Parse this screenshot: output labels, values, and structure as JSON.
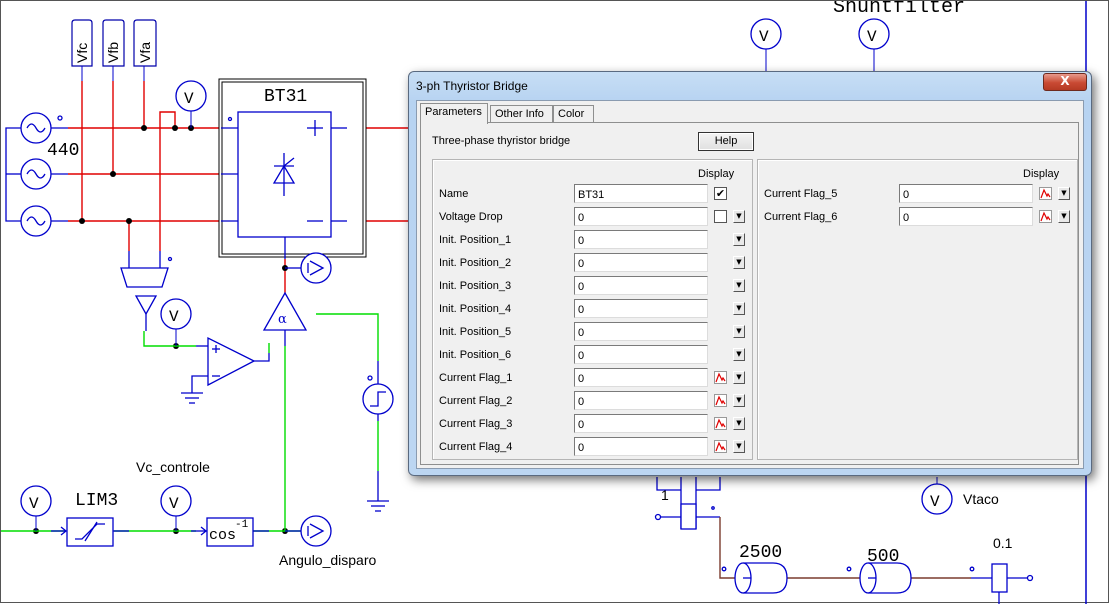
{
  "schematic": {
    "labels": {
      "vfc": "Vfc",
      "vfb": "Vfb",
      "vfa": "Vfa",
      "source_voltage": "440",
      "bridge_name": "BT31",
      "voltmeter": "V",
      "lim_block": "LIM3",
      "vc_controle": "Vc_controle",
      "cos_inverse": "cos",
      "cos_exponent": "-1",
      "angulo_disparo": "Angulo_disparo",
      "shunt_filter": "Shuntfilter",
      "vtaco": "Vtaco",
      "gain_1": "1",
      "inertia_2500": "2500",
      "inertia_500": "500",
      "damping_01": "0.1",
      "alpha_symbol": "α"
    },
    "wire_colors": {
      "power": "#e00000",
      "control": "#00dd00",
      "component": "#0000cc",
      "mechanical": "#7a3b2e"
    }
  },
  "dialog": {
    "title": "3-ph Thyristor Bridge",
    "close_label": "X",
    "tabs": [
      {
        "label": "Parameters",
        "active": true
      },
      {
        "label": "Other Info",
        "active": false
      },
      {
        "label": "Color",
        "active": false
      }
    ],
    "description": "Three-phase thyristor bridge",
    "help_label": "Help",
    "display_header": "Display",
    "left_params": [
      {
        "label": "Name",
        "value": "BT31",
        "display": "checkbox",
        "checked": true,
        "dropdown": false
      },
      {
        "label": "Voltage Drop",
        "value": "0",
        "display": "checkbox",
        "checked": false,
        "dropdown": true
      },
      {
        "label": "Init. Position_1",
        "value": "0",
        "display": "none",
        "dropdown": true
      },
      {
        "label": "Init. Position_2",
        "value": "0",
        "display": "none",
        "dropdown": true
      },
      {
        "label": "Init. Position_3",
        "value": "0",
        "display": "none",
        "dropdown": true
      },
      {
        "label": "Init. Position_4",
        "value": "0",
        "display": "none",
        "dropdown": true
      },
      {
        "label": "Init. Position_5",
        "value": "0",
        "display": "none",
        "dropdown": true
      },
      {
        "label": "Init. Position_6",
        "value": "0",
        "display": "none",
        "dropdown": true
      },
      {
        "label": "Current Flag_1",
        "value": "0",
        "display": "waveform",
        "dropdown": true
      },
      {
        "label": "Current Flag_2",
        "value": "0",
        "display": "waveform",
        "dropdown": true
      },
      {
        "label": "Current Flag_3",
        "value": "0",
        "display": "waveform",
        "dropdown": true
      },
      {
        "label": "Current Flag_4",
        "value": "0",
        "display": "waveform",
        "dropdown": true
      }
    ],
    "right_params": [
      {
        "label": "Current Flag_5",
        "value": "0",
        "display": "waveform",
        "dropdown": true
      },
      {
        "label": "Current Flag_6",
        "value": "0",
        "display": "waveform",
        "dropdown": true
      }
    ],
    "check_glyph": "✔",
    "dropdown_glyph": "▼"
  }
}
